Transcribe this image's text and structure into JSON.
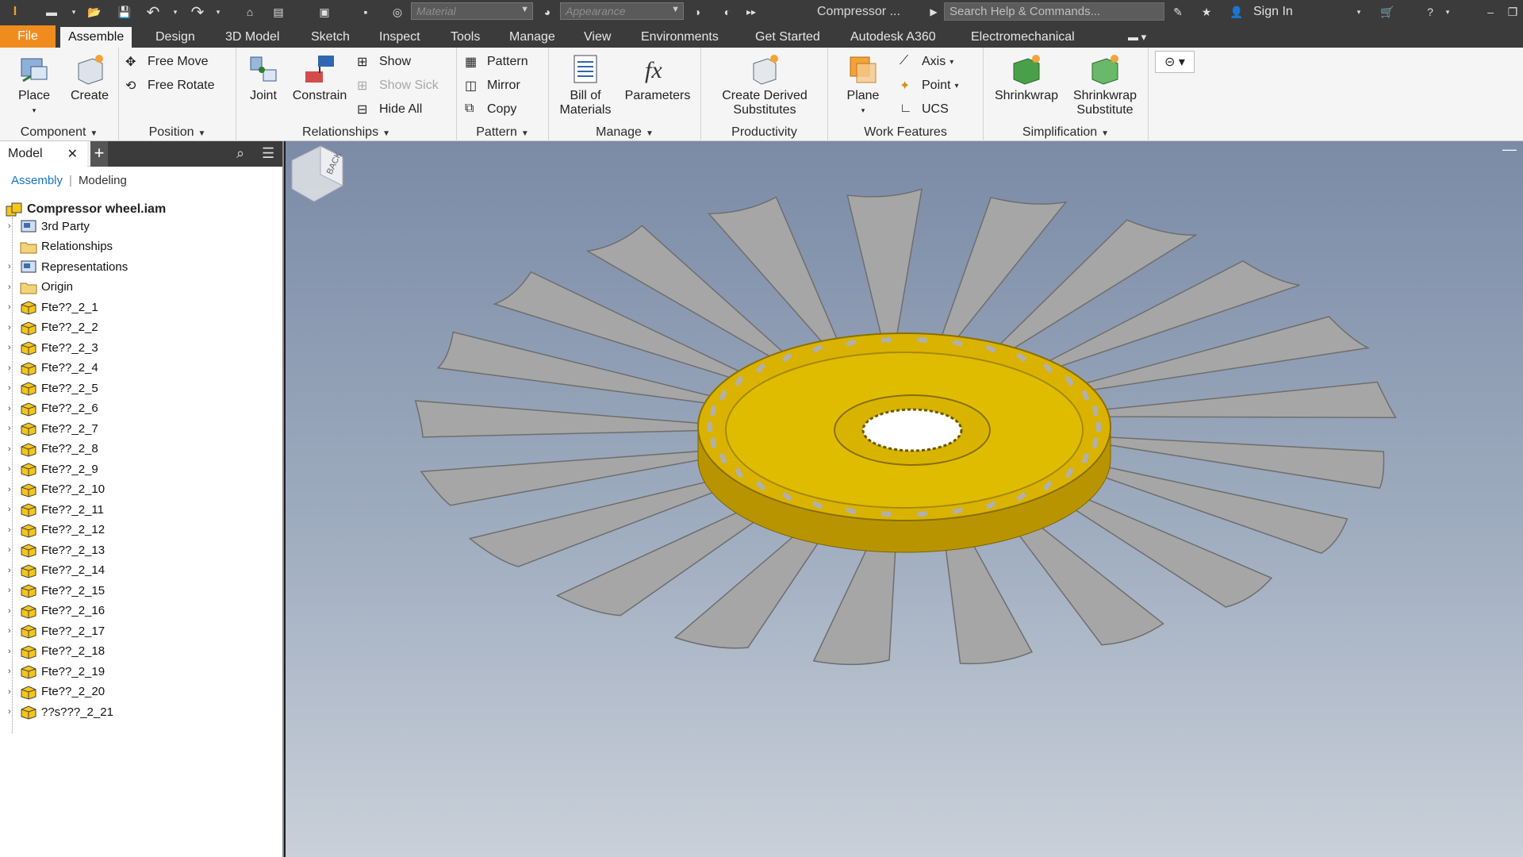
{
  "titlebar": {
    "app_logo": "I",
    "material_placeholder": "Material",
    "appearance_placeholder": "Appearance",
    "document_title": "Compressor ...",
    "search_placeholder": "Search Help & Commands...",
    "sign_in": "Sign In"
  },
  "tabs": {
    "file": "File",
    "items": [
      "Assemble",
      "Design",
      "3D Model",
      "Sketch",
      "Inspect",
      "Tools",
      "Manage",
      "View",
      "Environments",
      "Get Started",
      "Autodesk A360",
      "Electromechanical"
    ],
    "active": "Assemble"
  },
  "ribbon": {
    "component": {
      "title": "Component",
      "place": "Place",
      "create": "Create"
    },
    "position": {
      "title": "Position",
      "free_move": "Free Move",
      "free_rotate": "Free Rotate"
    },
    "relationships": {
      "title": "Relationships",
      "joint": "Joint",
      "constrain": "Constrain",
      "show": "Show",
      "show_sick": "Show Sick",
      "hide_all": "Hide All"
    },
    "pattern": {
      "title": "Pattern",
      "pattern": "Pattern",
      "mirror": "Mirror",
      "copy": "Copy"
    },
    "manage": {
      "title": "Manage",
      "bom_line1": "Bill of",
      "bom_line2": "Materials",
      "parameters": "Parameters"
    },
    "productivity": {
      "title": "Productivity",
      "cds_line1": "Create Derived",
      "cds_line2": "Substitutes"
    },
    "work_features": {
      "title": "Work Features",
      "plane": "Plane",
      "axis": "Axis",
      "point": "Point",
      "ucs": "UCS"
    },
    "simplification": {
      "title": "Simplification",
      "shrinkwrap": "Shrinkwrap",
      "sws_line1": "Shrinkwrap",
      "sws_line2": "Substitute"
    }
  },
  "browser": {
    "tab_label": "Model",
    "sub_assembly": "Assembly",
    "sub_modeling": "Modeling",
    "root": "Compressor wheel.iam",
    "items": [
      "3rd Party",
      "Relationships",
      "Representations",
      "Origin",
      "Fte??_2_1",
      "Fte??_2_2",
      "Fte??_2_3",
      "Fte??_2_4",
      "Fte??_2_5",
      "Fte??_2_6",
      "Fte??_2_7",
      "Fte??_2_8",
      "Fte??_2_9",
      "Fte??_2_10",
      "Fte??_2_11",
      "Fte??_2_12",
      "Fte??_2_13",
      "Fte??_2_14",
      "Fte??_2_15",
      "Fte??_2_16",
      "Fte??_2_17",
      "Fte??_2_18",
      "Fte??_2_19",
      "Fte??_2_20",
      "??s???_2_21"
    ]
  },
  "viewport": {
    "viewcube_face": "BACK",
    "hub_color": "#d9b300",
    "blade_color": "#a6a6a6"
  },
  "colors": {
    "file_tab": "#f08c1e",
    "titlebar": "#3b3b3b",
    "ribbon": "#f5f5f5"
  }
}
